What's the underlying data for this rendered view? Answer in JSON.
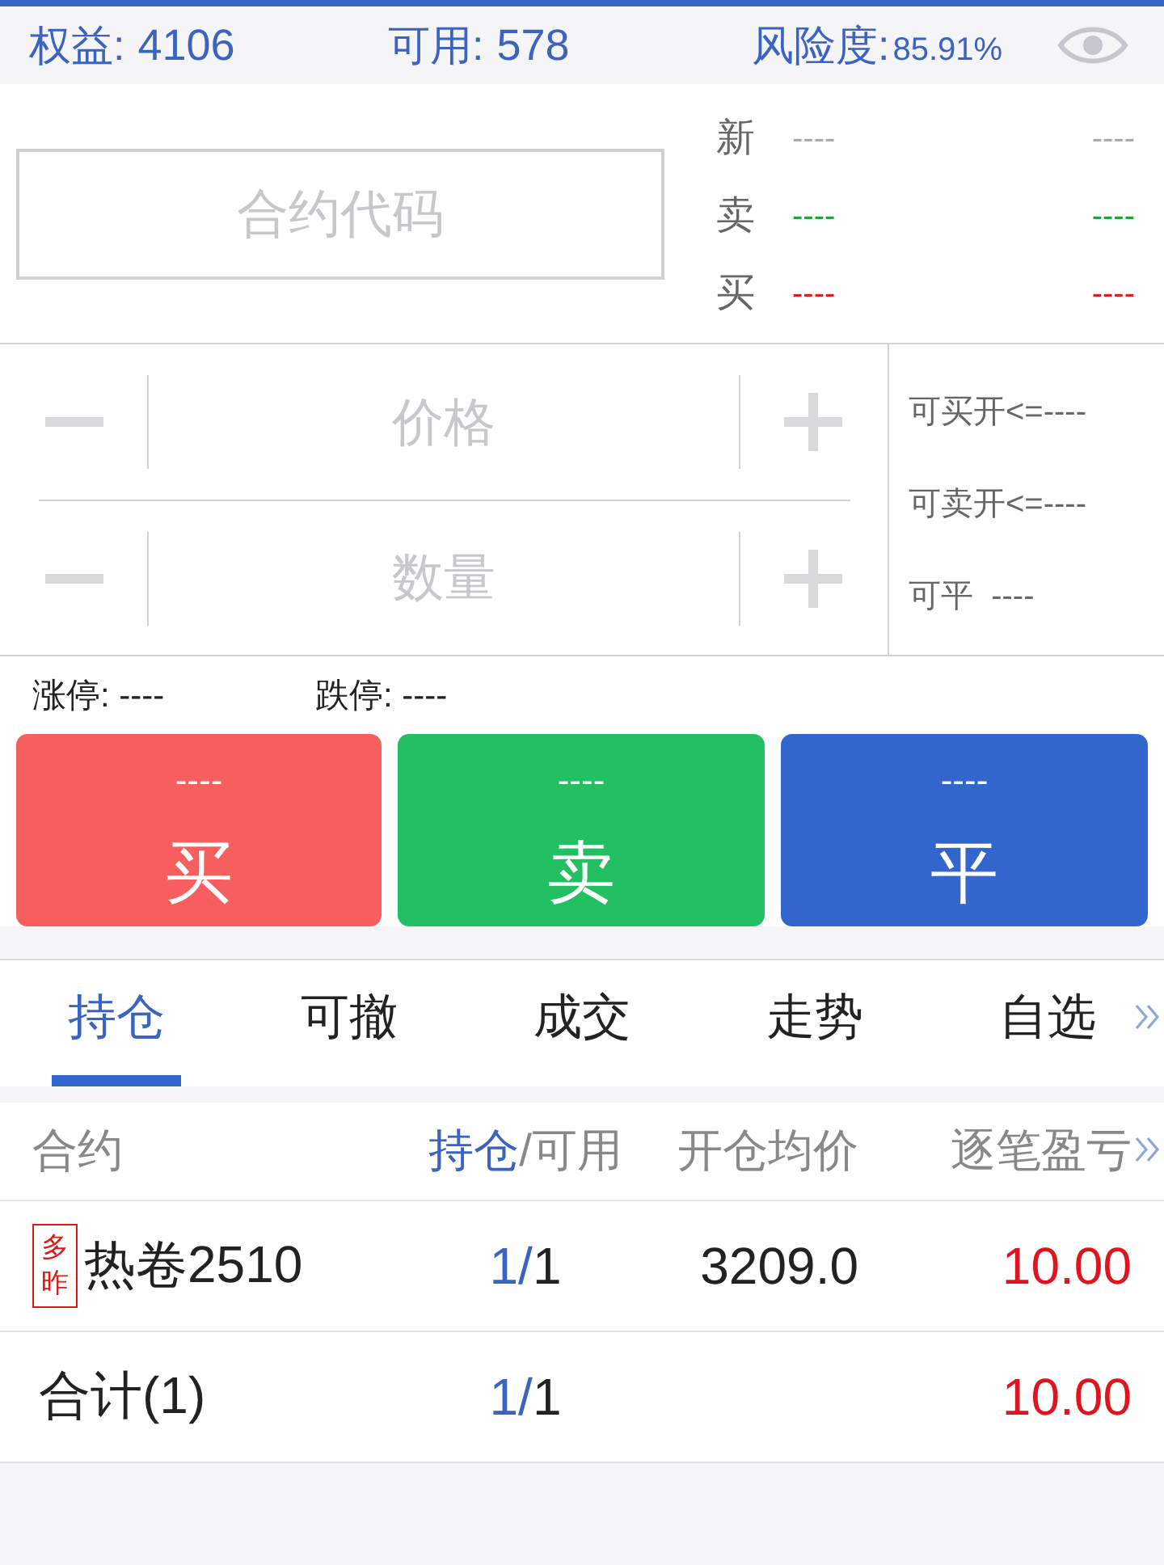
{
  "account": [
    {
      "kind": "amount",
      "label": "权益:",
      "value": "4106"
    },
    {
      "kind": "amount",
      "label": "可用:",
      "value": "578"
    },
    {
      "kind": "ratio",
      "label": "风险度:",
      "value": "85.91%"
    }
  ],
  "contract_field": {
    "placeholder": "合约代码"
  },
  "quotes": [
    {
      "label": "新",
      "values": [
        "----",
        "----"
      ],
      "color": "#aaaaaa"
    },
    {
      "label": "卖",
      "values": [
        "----",
        "----"
      ],
      "color": "#1fa23a"
    },
    {
      "label": "买",
      "values": [
        "----",
        "----"
      ],
      "color": "#e01818"
    }
  ],
  "order_fields": [
    {
      "placeholder": "价格"
    },
    {
      "placeholder": "数量"
    }
  ],
  "availability": [
    "可买开<=----",
    "可卖开<=----",
    "可平  ----"
  ],
  "price_limits": [
    "涨停: ----",
    "跌停: ----"
  ],
  "actions": [
    {
      "kind": "buy",
      "price": "----",
      "label": "买"
    },
    {
      "kind": "sell",
      "price": "----",
      "label": "卖"
    },
    {
      "kind": "close",
      "price": "----",
      "label": "平"
    }
  ],
  "tabs": [
    {
      "label": "持仓",
      "selected": true
    },
    {
      "label": "可撤",
      "selected": false
    },
    {
      "label": "成交",
      "selected": false
    },
    {
      "label": "走势",
      "selected": false
    },
    {
      "label": "自选",
      "selected": false
    }
  ],
  "table": {
    "columns": [
      {
        "parts": [
          {
            "text": "合约",
            "highlighted": false
          }
        ]
      },
      {
        "parts": [
          {
            "text": "持仓",
            "highlighted": true
          },
          {
            "text": "/可用",
            "highlighted": false
          }
        ]
      },
      {
        "parts": [
          {
            "text": "开仓均价",
            "highlighted": false
          }
        ]
      },
      {
        "parts": [
          {
            "text": "逐笔盈亏",
            "highlighted": false
          }
        ]
      }
    ],
    "rows": [
      {
        "badge": "多昨",
        "contract": "热卷2510",
        "position": [
          {
            "text": "1/",
            "highlighted": true
          },
          {
            "text": "1",
            "highlighted": false
          }
        ],
        "avg_price": "3209.0",
        "pnl": "10.00"
      },
      {
        "contract": "合计(1)",
        "position": [
          {
            "text": "1/",
            "highlighted": true
          },
          {
            "text": "1",
            "highlighted": false
          }
        ],
        "pnl": "10.00"
      }
    ]
  }
}
